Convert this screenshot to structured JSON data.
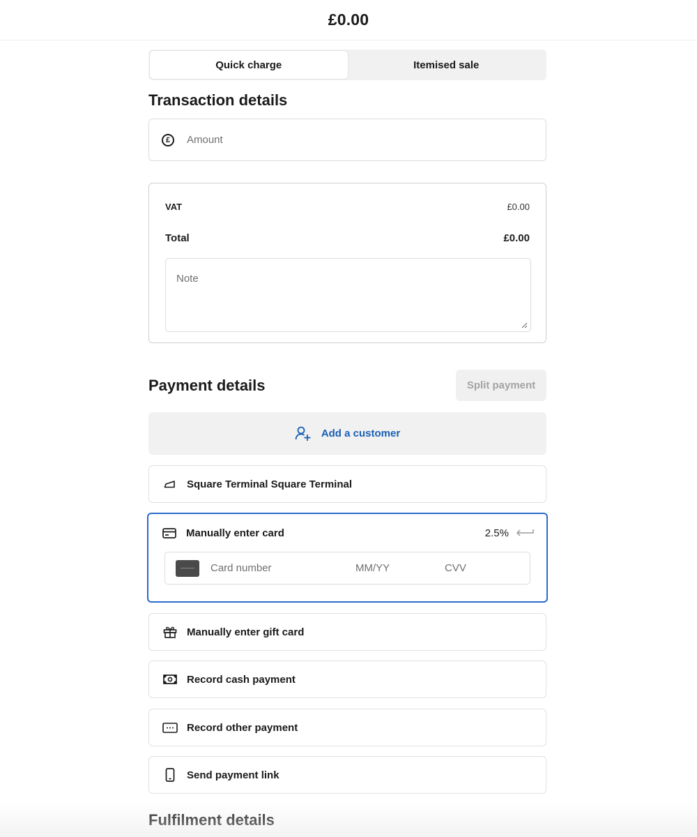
{
  "header": {
    "amount": "£0.00"
  },
  "tabs": [
    {
      "label": "Quick charge",
      "active": true
    },
    {
      "label": "Itemised sale",
      "active": false
    }
  ],
  "transaction": {
    "title": "Transaction details",
    "amount_placeholder": "Amount",
    "amount_icon": "pound-circle-icon",
    "vat_label": "VAT",
    "vat_value": "£0.00",
    "total_label": "Total",
    "total_value": "£0.00",
    "note_placeholder": "Note"
  },
  "payment": {
    "title": "Payment details",
    "split_label": "Split payment",
    "add_customer_label": "Add a customer",
    "accent_color": "#1a5fb4",
    "selected_border_color": "#2a6bcc",
    "options": {
      "terminal": {
        "label": "Square Terminal Square Terminal",
        "icon": "terminal-icon"
      },
      "manual_card": {
        "label": "Manually enter card",
        "icon": "credit-card-icon",
        "rate": "2.5%",
        "card_number_placeholder": "Card number",
        "expiry_placeholder": "MM/YY",
        "cvv_placeholder": "CVV"
      },
      "gift_card": {
        "label": "Manually enter gift card",
        "icon": "gift-icon"
      },
      "cash": {
        "label": "Record cash payment",
        "icon": "cash-icon"
      },
      "other": {
        "label": "Record other payment",
        "icon": "other-payment-icon"
      },
      "link": {
        "label": "Send payment link",
        "icon": "phone-icon"
      }
    }
  },
  "fulfilment": {
    "title": "Fulfilment details"
  }
}
